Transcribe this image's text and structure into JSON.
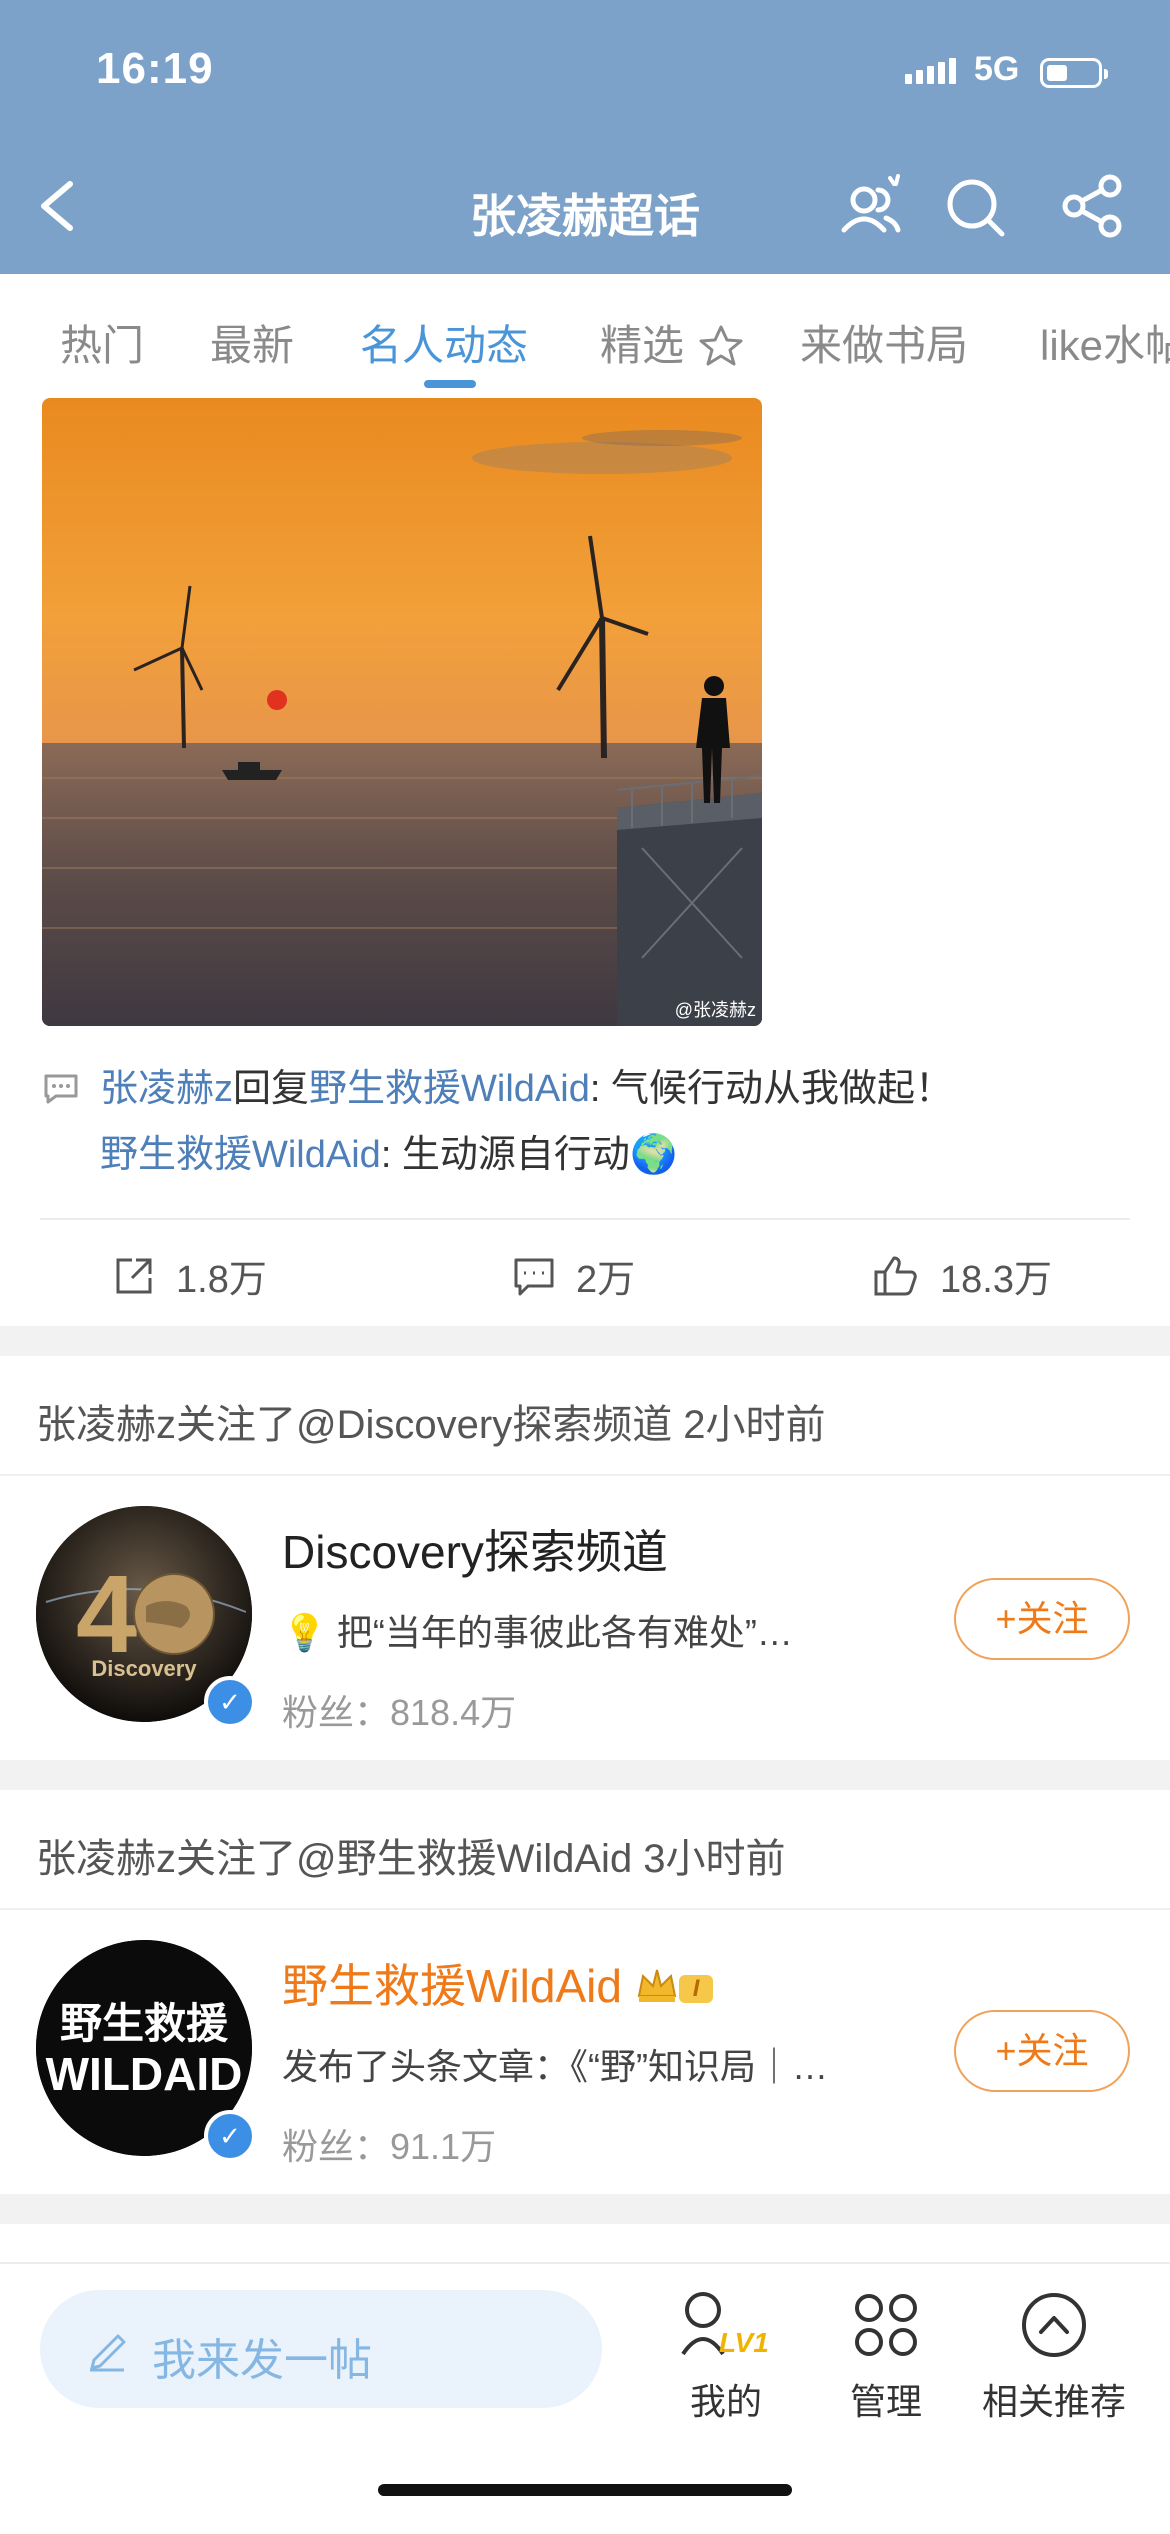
{
  "status_bar": {
    "time": "16:19",
    "network": "5G"
  },
  "header": {
    "title": "张凌赫超话"
  },
  "tabs": [
    {
      "label": "热门"
    },
    {
      "label": "最新"
    },
    {
      "label": "名人动态",
      "active": true
    },
    {
      "label": "精选"
    },
    {
      "label": "来做书局"
    },
    {
      "label": "like水帖"
    }
  ],
  "post": {
    "watermark": "@张凌赫z",
    "repost": {
      "author": "张凌赫z",
      "verb": "回复",
      "target": "野生救援WildAid",
      "reply_text": ": 气候行动从我做起！",
      "orig_author": "野生救援WildAid",
      "orig_text": ": 生动源自行动",
      "orig_emoji": "🌍"
    },
    "stats": {
      "shares": "1.8万",
      "comments": "2万",
      "likes": "18.3万"
    }
  },
  "follow_events": [
    {
      "note": "张凌赫z关注了@Discovery探索频道 2小时前",
      "name": "Discovery探索频道",
      "desc": "💡 把“当年的事彼此各有难处”…",
      "fans": "粉丝：818.4万",
      "button": "+关注",
      "avatar_text": "Discovery"
    },
    {
      "note": "张凌赫z关注了@野生救援WildAid 3小时前",
      "name": "野生救援WildAid",
      "badge": "I",
      "desc": "发布了头条文章：《“野”知识局｜…",
      "fans": "粉丝：91.1万",
      "button": "+关注",
      "avatar_line1": "野生救援",
      "avatar_line2": "WILDAID"
    }
  ],
  "bottom_bar": {
    "compose_placeholder": "我来发一帖",
    "level": "LV1",
    "nav": [
      {
        "label": "我的"
      },
      {
        "label": "管理"
      },
      {
        "label": "相关推荐"
      }
    ]
  },
  "colors": {
    "header_bg": "#7ca2c9",
    "accent_blue": "#4a95d8",
    "link": "#4e7fb8",
    "follow_orange": "#ee7a1a"
  }
}
